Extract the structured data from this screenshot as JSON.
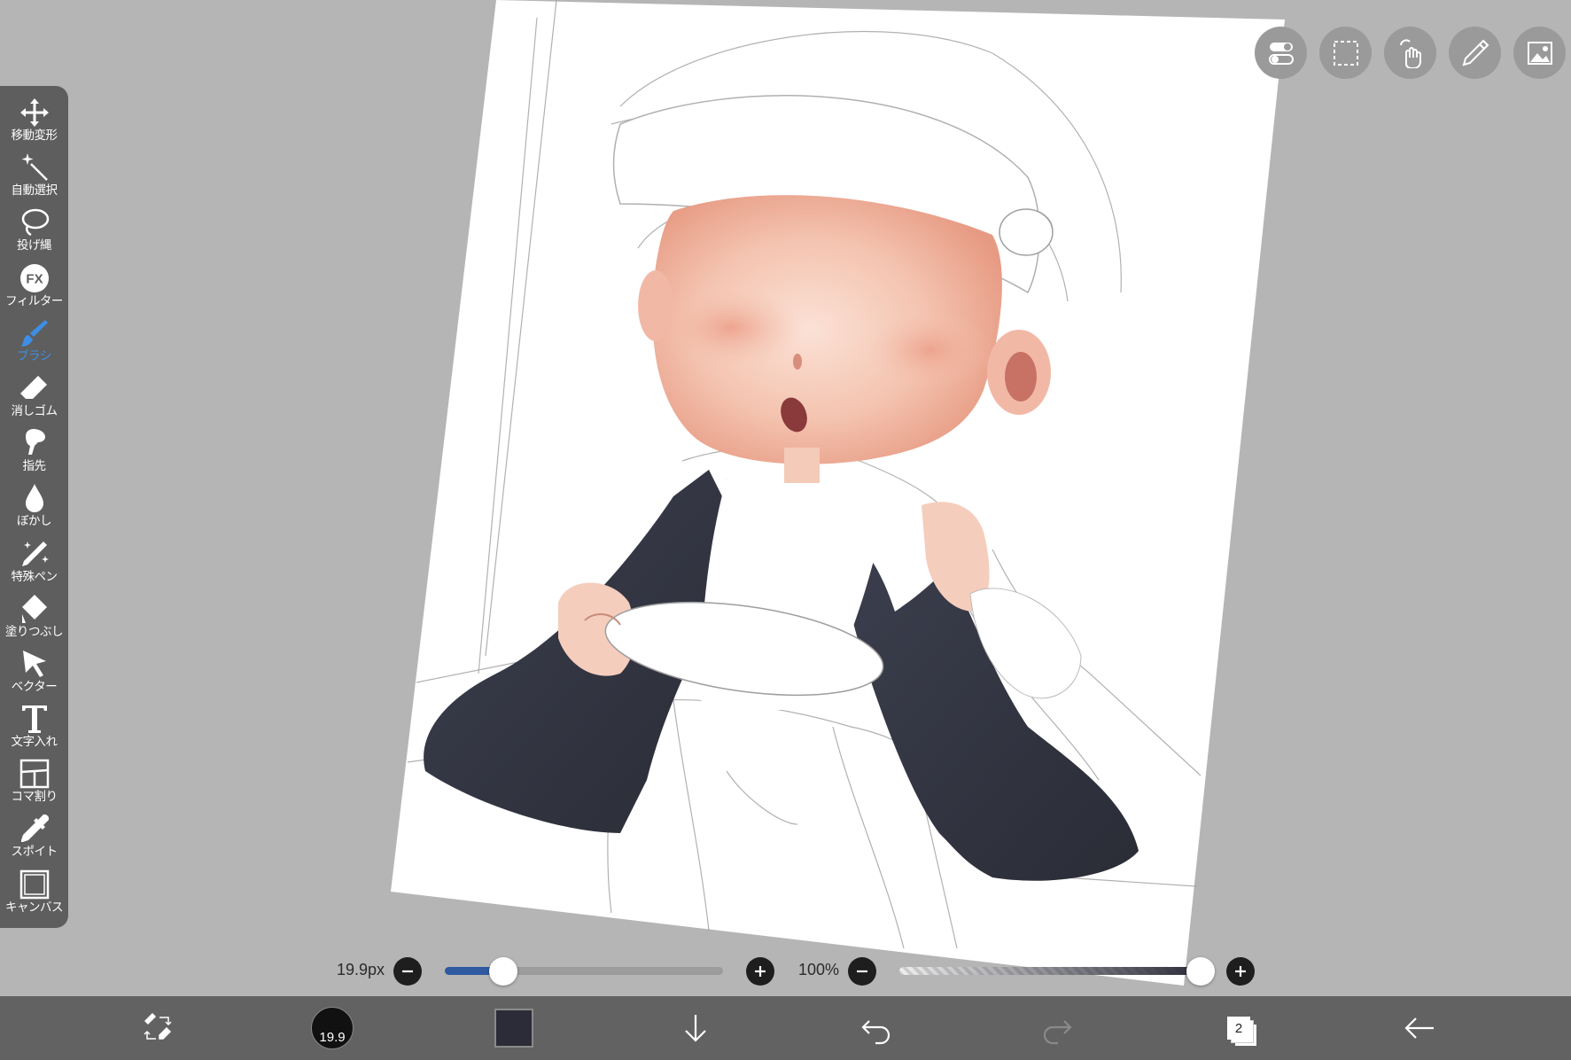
{
  "tools": [
    {
      "id": "move",
      "label": "移動変形",
      "icon": "move-icon"
    },
    {
      "id": "magic-wand",
      "label": "自動選択",
      "icon": "magic-wand-icon"
    },
    {
      "id": "lasso",
      "label": "投げ縄",
      "icon": "lasso-icon"
    },
    {
      "id": "filter",
      "label": "フィルター",
      "icon": "fx-icon"
    },
    {
      "id": "brush",
      "label": "ブラシ",
      "icon": "brush-icon",
      "active": true
    },
    {
      "id": "eraser",
      "label": "消しゴム",
      "icon": "eraser-icon"
    },
    {
      "id": "finger",
      "label": "指先",
      "icon": "finger-icon"
    },
    {
      "id": "blur",
      "label": "ぼかし",
      "icon": "drop-icon"
    },
    {
      "id": "special-pen",
      "label": "特殊ペン",
      "icon": "sparkle-pen-icon"
    },
    {
      "id": "fill",
      "label": "塗りつぶし",
      "icon": "bucket-icon"
    },
    {
      "id": "vector",
      "label": "ベクター",
      "icon": "cursor-icon"
    },
    {
      "id": "text",
      "label": "文字入れ",
      "icon": "text-icon"
    },
    {
      "id": "frame",
      "label": "コマ割り",
      "icon": "frame-divider-icon"
    },
    {
      "id": "eyedropper",
      "label": "スポイト",
      "icon": "eyedropper-icon"
    },
    {
      "id": "canvas",
      "label": "キャンバス",
      "icon": "canvas-icon"
    }
  ],
  "top_actions": [
    "toggle-icon",
    "selection-icon",
    "gesture-hand-icon",
    "ruler-pen-icon",
    "image-icon"
  ],
  "brush_size": {
    "label": "19.9px",
    "fraction": 0.21
  },
  "opacity": {
    "label": "100%",
    "fraction": 1.0
  },
  "bottom_bar": {
    "brush_indicator": "19.9",
    "color": "#2c2c39",
    "layer_count": "2"
  },
  "colors": {
    "accent": "#3d8fe6",
    "toolbar_bg": "#5e5e5e",
    "canvas_bg": "#b5b5b5"
  }
}
